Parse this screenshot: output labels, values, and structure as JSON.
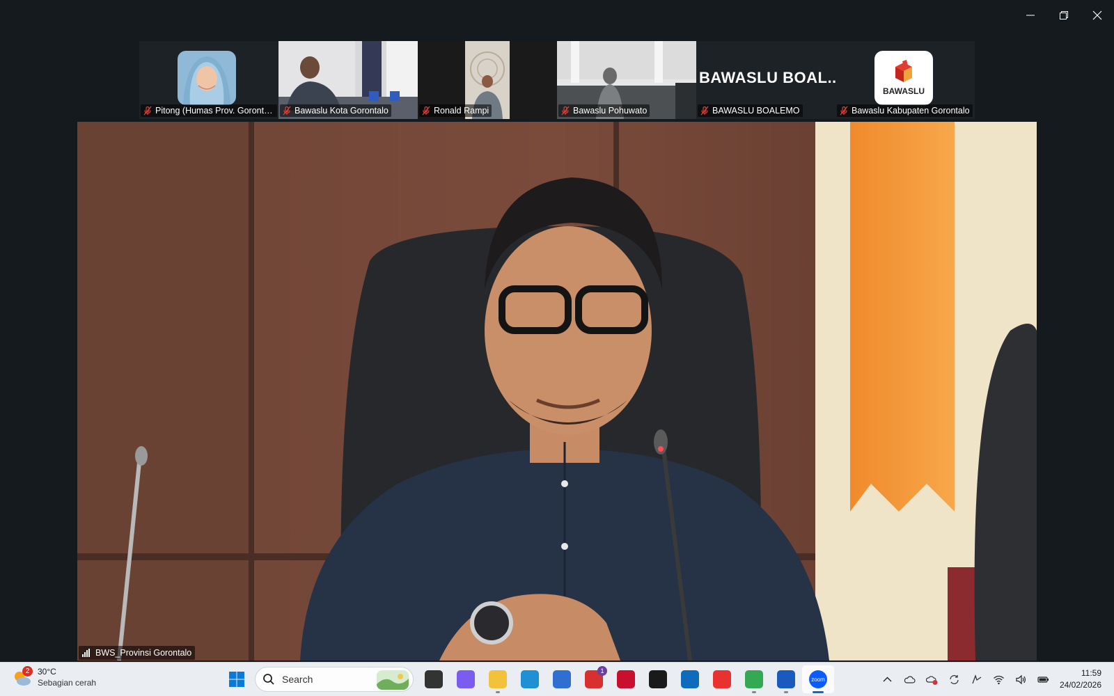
{
  "participants": [
    {
      "name": "Pitong (Humas Prov. Gorontal...",
      "type": "photo"
    },
    {
      "name": "Bawaslu Kota Gorontalo",
      "type": "video"
    },
    {
      "name": "Ronald Rampi",
      "type": "video"
    },
    {
      "name": "Bawaslu Pohuwato",
      "type": "video"
    },
    {
      "name": "BAWASLU BOALEMO",
      "type": "name",
      "display": "BAWASLU  BOAL..."
    },
    {
      "name": "Bawaslu Kabupaten Gorontalo",
      "type": "logo",
      "logo_text": "BAWASLU"
    }
  ],
  "main_speaker": {
    "name": "BWS_Provinsi Gorontalo"
  },
  "taskbar": {
    "weather": {
      "temp": "30°C",
      "desc": "Sebagian cerah",
      "badge": "2"
    },
    "search_placeholder": "Search",
    "apps": [
      {
        "name": "task-view",
        "color": "#333333"
      },
      {
        "name": "copilot",
        "color": "#7b5cf0"
      },
      {
        "name": "file-explorer",
        "color": "#f3c13a"
      },
      {
        "name": "edge",
        "color": "#1f8fd6"
      },
      {
        "name": "microsoft-store",
        "color": "#2f6fd1"
      },
      {
        "name": "l-app",
        "color": "#d8302f",
        "badge": "1"
      },
      {
        "name": "mcafee",
        "color": "#c8102e"
      },
      {
        "name": "dropbox",
        "color": "#1a1a1a"
      },
      {
        "name": "outlook",
        "color": "#0f6cbd"
      },
      {
        "name": "wps-office",
        "color": "#e8322f"
      },
      {
        "name": "chrome",
        "color": "#34a853"
      },
      {
        "name": "word",
        "color": "#185abd"
      },
      {
        "name": "zoom",
        "color": "#0b5cff",
        "active": true,
        "label": "zoom"
      }
    ],
    "clock": {
      "time": "11:59",
      "date": "24/02/2026"
    }
  }
}
